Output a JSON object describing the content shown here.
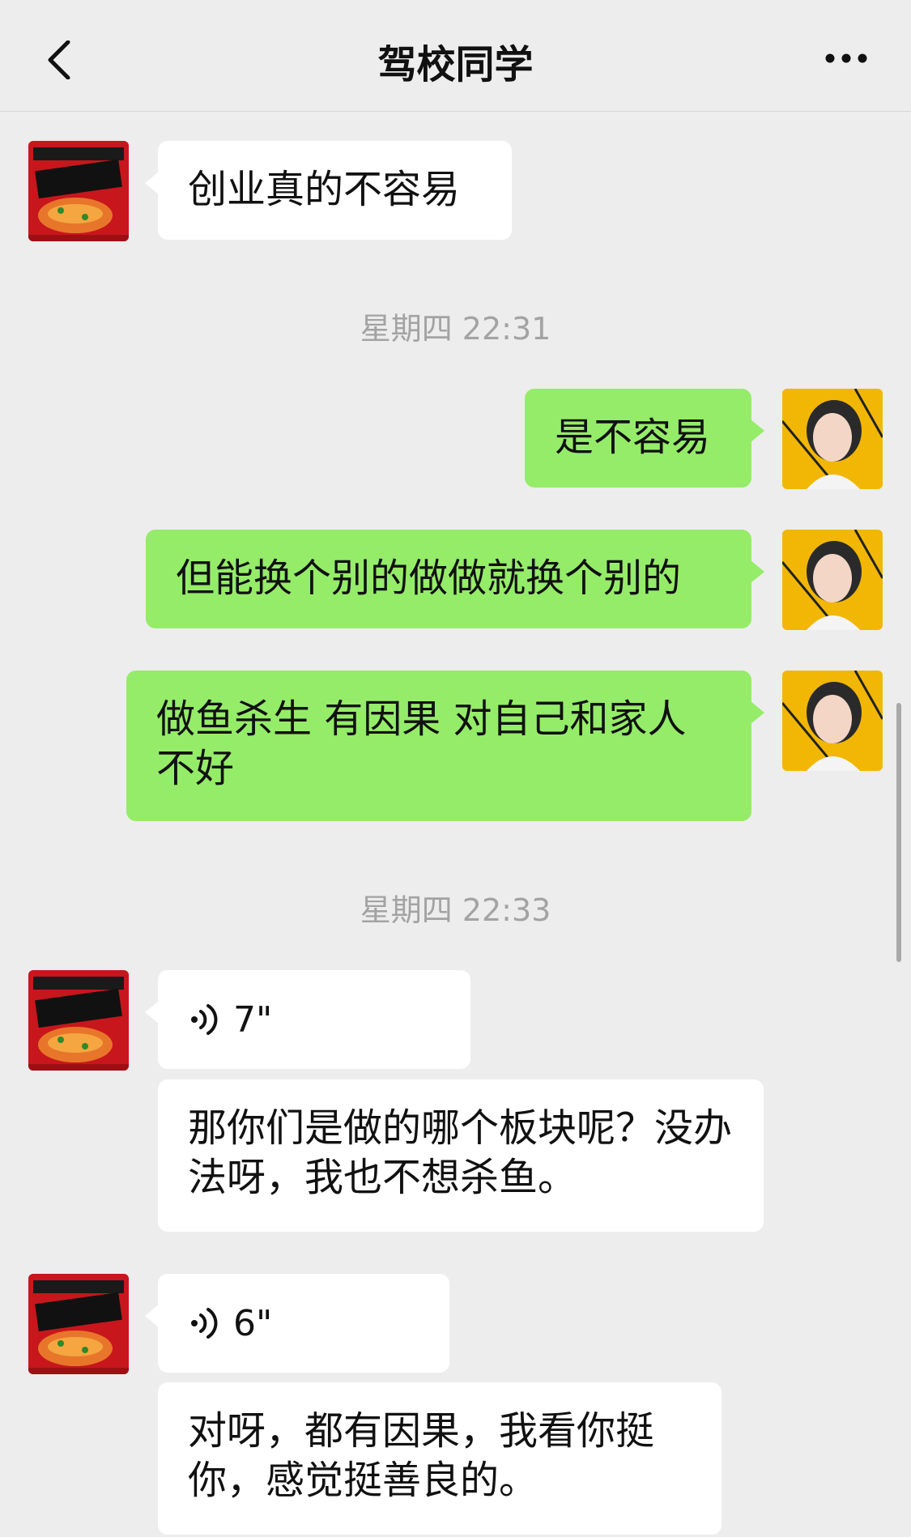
{
  "header": {
    "title": "驾校同学"
  },
  "timestamps": [
    "星期四 22:31",
    "星期四 22:33"
  ],
  "messages": {
    "m1": "创业真的不容易",
    "m2": "是不容易",
    "m3": "但能换个别的做做就换个别的",
    "m4": "做鱼杀生 有因果 对自己和家人不好",
    "m5_duration": "7\"",
    "m6": "那你们是做的哪个板块呢？没办法呀，我也不想杀鱼。",
    "m7_duration": "6\"",
    "m8": "对呀，都有因果，我看你挺你，感觉挺善良的。"
  },
  "colors": {
    "background": "#ededed",
    "incoming_bubble": "#ffffff",
    "outgoing_bubble": "#95ec69",
    "timestamp": "#a3a3a3"
  },
  "icons": {
    "back": "chevron-left-icon",
    "more": "more-dots-icon",
    "voice": "voice-wave-icon"
  }
}
